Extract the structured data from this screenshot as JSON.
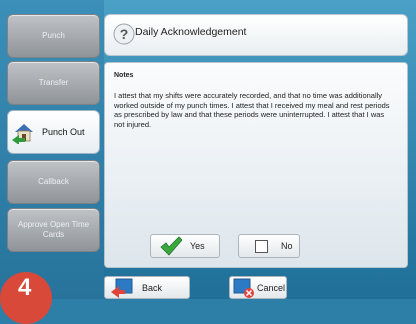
{
  "sidebar": {
    "items": [
      {
        "label": "Punch"
      },
      {
        "label": "Transfer"
      },
      {
        "label": "Punch Out"
      },
      {
        "label": "Callback"
      },
      {
        "label": "Approve Open Time Cards"
      }
    ]
  },
  "header": {
    "title": "Daily Acknowledgement"
  },
  "notes": {
    "label": "Notes",
    "text": "I attest that my shifts were accurately recorded, and that no time was additionally worked outside of my punch times. I attest that I received my meal and rest periods as prescribed by law and that these periods were uninterrupted.  I attest that I was not injured."
  },
  "buttons": {
    "yes": "Yes",
    "no": "No",
    "back": "Back",
    "cancel": "Cancel"
  },
  "badge": {
    "text": "4"
  }
}
